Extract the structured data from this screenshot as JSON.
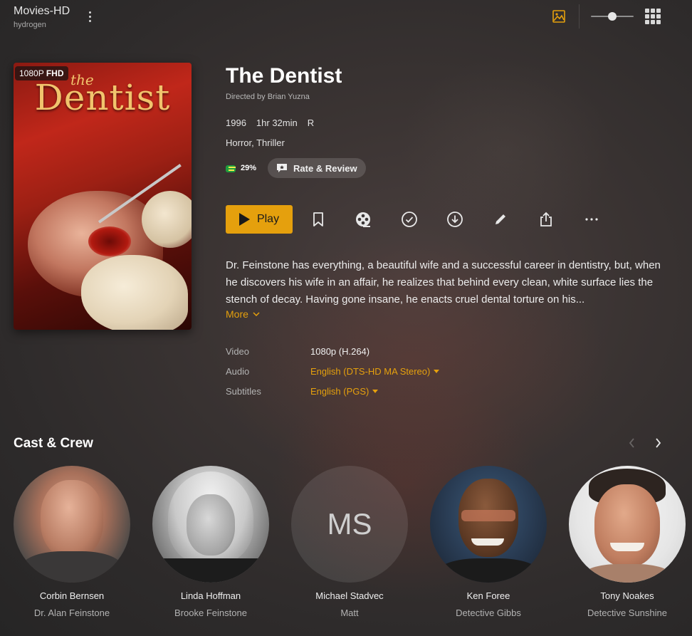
{
  "header": {
    "library_title": "Movies-HD",
    "server_name": "hydrogen"
  },
  "poster": {
    "resolution_prefix": "1080P",
    "resolution_suffix": "FHD",
    "art_title_small": "the",
    "art_title": "Dentist"
  },
  "movie": {
    "title": "The Dentist",
    "directed_by": "Directed by Brian Yuzna",
    "year": "1996",
    "duration": "1hr 32min",
    "content_rating": "R",
    "genres": "Horror, Thriller",
    "audience_score": "29%",
    "rate_review_label": "Rate & Review",
    "play_label": "Play",
    "summary": "Dr. Feinstone has everything, a beautiful wife and a successful career in dentistry, but, when he discovers his wife in an affair, he realizes that behind every clean, white surface lies the stench of decay. Having gone insane, he enacts cruel dental torture on his...",
    "more_label": "More"
  },
  "specs": {
    "video_label": "Video",
    "video_value": "1080p (H.264)",
    "audio_label": "Audio",
    "audio_value": "English (DTS-HD MA Stereo)",
    "subtitles_label": "Subtitles",
    "subtitles_value": "English (PGS)"
  },
  "cast_section": {
    "title": "Cast & Crew",
    "members": [
      {
        "name": "Corbin Bernsen",
        "role": "Dr. Alan Feinstone"
      },
      {
        "name": "Linda Hoffman",
        "role": "Brooke Feinstone"
      },
      {
        "name": "Michael Stadvec",
        "role": "Matt",
        "initials": "MS"
      },
      {
        "name": "Ken Foree",
        "role": "Detective Gibbs"
      },
      {
        "name": "Tony Noakes",
        "role": "Detective Sunshine"
      }
    ]
  },
  "colors": {
    "accent": "#e5a00d",
    "background": "#2e2b2b",
    "text_primary": "#ffffff",
    "text_secondary": "#b3b3b3"
  },
  "icons": {
    "more_options": "kebab-icon",
    "background_art_toggle": "image-icon",
    "grid_view": "grid-icon",
    "watchlist": "bookmark-icon",
    "trailer": "film-reel-icon",
    "mark_watched": "check-circle-icon",
    "download": "download-icon",
    "edit": "pencil-icon",
    "share": "share-icon",
    "more": "ellipsis-icon"
  }
}
